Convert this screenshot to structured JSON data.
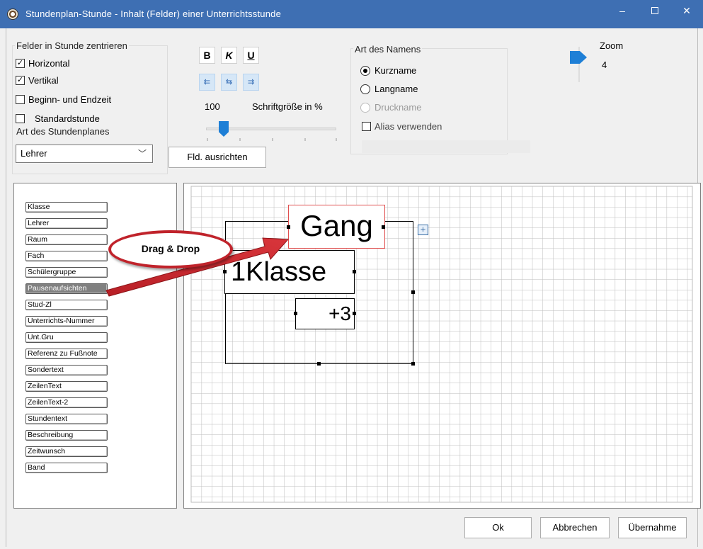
{
  "window": {
    "title": "Stundenplan-Stunde - Inhalt (Felder) einer Unterrichtsstunde",
    "controls": {
      "minimize": "‒",
      "close": "✕"
    }
  },
  "center_group": {
    "title": "Felder in Stunde zentrieren",
    "horizontal": {
      "label": "Horizontal",
      "checked": true
    },
    "vertical": {
      "label": "Vertikal",
      "checked": true
    }
  },
  "options": {
    "beginn_endzeit": {
      "label": "Beginn- und Endzeit",
      "checked": false
    },
    "standardstunde": {
      "label": "Standardstunde",
      "checked": false
    }
  },
  "plan_type": {
    "title": "Art des Stundenplanes",
    "selected": "Lehrer"
  },
  "format": {
    "bold": "B",
    "italic": "K",
    "underline": "U",
    "font_size_value": "100",
    "font_size_label": "Schriftgröße in %",
    "font_size_percent": 100,
    "align_button": "Fld. ausrichten"
  },
  "name_type": {
    "title": "Art des Namens",
    "options": [
      {
        "label": "Kurzname",
        "selected": true,
        "enabled": true
      },
      {
        "label": "Langname",
        "selected": false,
        "enabled": true
      },
      {
        "label": "Druckname",
        "selected": false,
        "enabled": false
      }
    ],
    "alias": {
      "label": "Alias verwenden",
      "checked": false
    }
  },
  "zoom": {
    "label": "Zoom",
    "value": "4"
  },
  "fields": [
    "Klasse",
    "Lehrer",
    "Raum",
    "Fach",
    "Schülergruppe",
    "Pausenaufsichten",
    "Stud-Zl",
    "Unterrichts-Nummer",
    "Unt.Gru",
    "Referenz zu Fußnote",
    "Sondertext",
    "ZeilenText",
    "ZeilenText-2",
    "Stundentext",
    "Beschreibung",
    "Zeitwunsch",
    "Band"
  ],
  "selected_field": "Pausenaufsichten",
  "canvas": {
    "field_gang": "Gang",
    "field_klasse": "1Klasse",
    "field_plus": "+3"
  },
  "annotation": {
    "label": "Drag & Drop"
  },
  "footer": {
    "ok": "Ok",
    "cancel": "Abbrechen",
    "apply": "Übernahme"
  },
  "colors": {
    "titlebar": "#3e6fb3",
    "accent": "#1e7fd6",
    "annotation": "#c0232b",
    "selected_field": "#808080"
  }
}
